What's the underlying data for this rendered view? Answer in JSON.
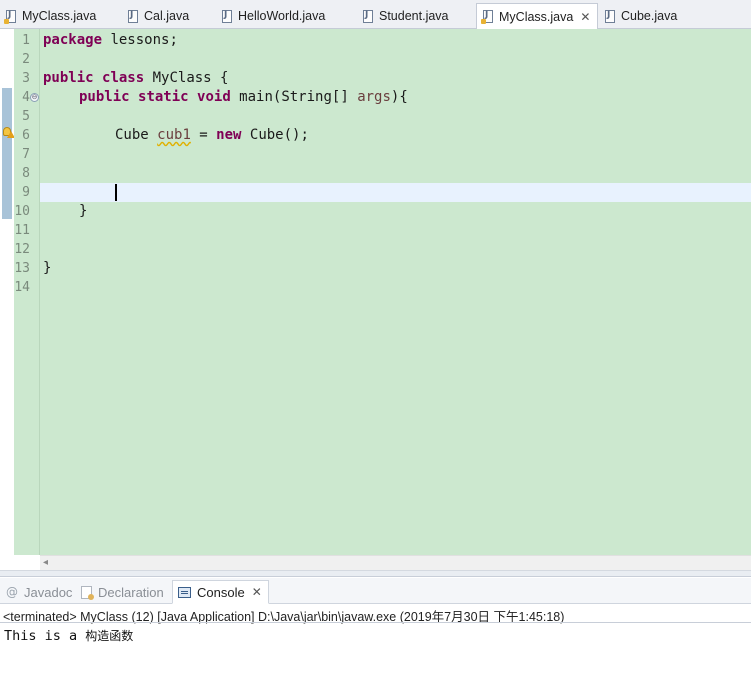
{
  "editor_tabs": [
    {
      "label": "MyClass.java",
      "icon": "java-file-warning-icon",
      "active": false
    },
    {
      "label": "Cal.java",
      "icon": "java-file-icon",
      "active": false
    },
    {
      "label": "HelloWorld.java",
      "icon": "java-file-icon",
      "active": false
    },
    {
      "label": "Student.java",
      "icon": "java-file-icon",
      "active": false
    },
    {
      "label": "MyClass.java",
      "icon": "java-file-warning-icon",
      "active": true,
      "close": "✕"
    },
    {
      "label": "Cube.java",
      "icon": "java-file-icon",
      "active": false
    }
  ],
  "editor": {
    "line_numbers": [
      "1",
      "2",
      "3",
      "4",
      "5",
      "6",
      "7",
      "8",
      "9",
      "10",
      "11",
      "12",
      "13",
      "14"
    ],
    "code": {
      "l1_kw": "package",
      "l1_rest": " lessons;",
      "l3_kw1": "public",
      "l3_kw2": "class",
      "l3_rest": " MyClass {",
      "l4_kw1": "public",
      "l4_kw2": "static",
      "l4_kw3": "void",
      "l4_rest1": " main(String[] ",
      "l4_param": "args",
      "l4_rest2": "){",
      "l6_pre": "Cube ",
      "l6_var": "cub1",
      "l6_mid": " = ",
      "l6_kw": "new",
      "l6_rest": " Cube();",
      "l10": "}",
      "l13": "}"
    },
    "fold_symbol": "⊖",
    "current_line": 9,
    "colors": {
      "background": "#cce8cf",
      "current_line": "#e8f2fe",
      "keyword": "#7f0055"
    }
  },
  "scrollbar": {
    "left_arrow": "◂"
  },
  "views": {
    "tabs": [
      {
        "label": "Javadoc",
        "icon": "at-icon"
      },
      {
        "label": "Declaration",
        "icon": "declaration-icon"
      },
      {
        "label": "Console",
        "icon": "console-icon",
        "active": true,
        "close": "✕"
      }
    ],
    "at_symbol": "@"
  },
  "console": {
    "status": "<terminated> MyClass (12) [Java Application] D:\\Java\\jar\\bin\\javaw.exe (2019年7月30日 下午1:45:18)",
    "output_ascii": "This is a ",
    "output_cjk": "构造函数"
  }
}
